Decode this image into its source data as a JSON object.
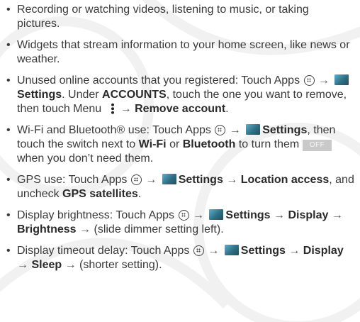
{
  "colors": {
    "text": "#3a3a3a",
    "settings_icon": "#2f6f86",
    "off_toggle_bg": "#c9c9c9"
  },
  "icons": {
    "apps": "apps-icon",
    "settings": "settings-icon",
    "menu": "menu-icon",
    "arrow": "→"
  },
  "items": [
    {
      "text": "Recording or watching videos, listening to music, or taking pictures."
    },
    {
      "text": "Widgets that stream information to your home screen, like news or weather."
    },
    {
      "t1": "Unused online accounts that you registered: Touch Apps",
      "b1": "Settings",
      "t2": ". Under",
      "b2": "ACCOUNTS",
      "t3": ", touch the one you want to remove, then touch Menu",
      "b3": "Remove account",
      "t4": "."
    },
    {
      "t1": "Wi-Fi and Bluetooth® use: Touch Apps",
      "b1": "Settings",
      "t2": ", then touch the switch next to",
      "b2": "Wi-Fi",
      "t3": "or",
      "b3": "Bluetooth",
      "t4": "to turn them",
      "toggle": "OFF",
      "t5": "when you don’t need them."
    },
    {
      "t1": "GPS use: Touch Apps",
      "b1": "Settings",
      "b2": "Location access",
      "t2": ", and uncheck",
      "b3": "GPS satellites",
      "t3": "."
    },
    {
      "t1": "Display brightness: Touch Apps",
      "b1": "Settings",
      "b2": "Display",
      "b3": "Brightness",
      "t2": "(slide dimmer setting left)."
    },
    {
      "t1": "Display timeout delay: Touch Apps",
      "b1": "Settings",
      "b2": "Display",
      "b3": "Sleep",
      "t2": "(shorter setting)."
    }
  ]
}
